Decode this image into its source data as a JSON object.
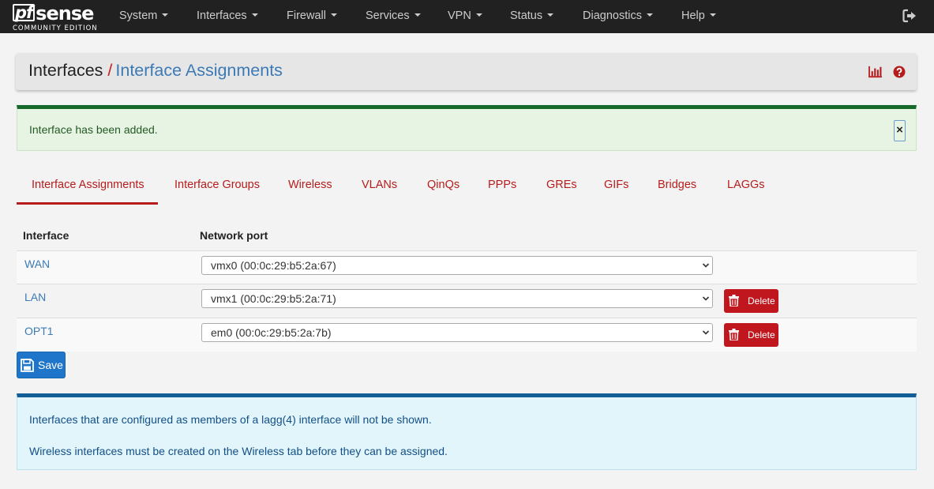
{
  "brand": {
    "name_pf": "pf",
    "name_rest": "sense",
    "edition": "COMMUNITY EDITION"
  },
  "nav": {
    "items": [
      {
        "label": "System"
      },
      {
        "label": "Interfaces"
      },
      {
        "label": "Firewall"
      },
      {
        "label": "Services"
      },
      {
        "label": "VPN"
      },
      {
        "label": "Status"
      },
      {
        "label": "Diagnostics"
      },
      {
        "label": "Help"
      }
    ],
    "logout_icon": "sign-out-icon"
  },
  "breadcrumb": {
    "parent": "Interfaces",
    "separator": "/",
    "current": "Interface Assignments",
    "icons": [
      "bar-chart-icon",
      "question-circle-icon"
    ]
  },
  "success_alert": {
    "message": "Interface has been added.",
    "close": "×"
  },
  "tabs": [
    {
      "label": "Interface Assignments",
      "active": true
    },
    {
      "label": "Interface Groups"
    },
    {
      "label": "Wireless"
    },
    {
      "label": "VLANs"
    },
    {
      "label": "QinQs"
    },
    {
      "label": "PPPs"
    },
    {
      "label": "GREs"
    },
    {
      "label": "GIFs"
    },
    {
      "label": "Bridges"
    },
    {
      "label": "LAGGs"
    }
  ],
  "table": {
    "headers": {
      "interface": "Interface",
      "port": "Network port"
    },
    "rows": [
      {
        "interface": "WAN",
        "port": "vmx0 (00:0c:29:b5:2a:67)",
        "deletable": false
      },
      {
        "interface": "LAN",
        "port": "vmx1 (00:0c:29:b5:2a:71)",
        "deletable": true,
        "delete_label": "Delete"
      },
      {
        "interface": "OPT1",
        "port": "em0 (00:0c:29:b5:2a:7b)",
        "deletable": true,
        "delete_label": "Delete"
      }
    ]
  },
  "save_button": {
    "label": "Save",
    "icon": "save-icon"
  },
  "info_alert": {
    "lines": [
      "Interfaces that are configured as members of a lagg(4) interface will not be shown.",
      "Wireless interfaces must be created on the Wireless tab before they can be assigned."
    ]
  },
  "colors": {
    "navbar": "#212121",
    "accent_red": "#b71c1c",
    "link_blue": "#3c7ab5",
    "success_border": "#16682b",
    "info_border": "#135e97",
    "save_blue": "#1f75c9"
  }
}
